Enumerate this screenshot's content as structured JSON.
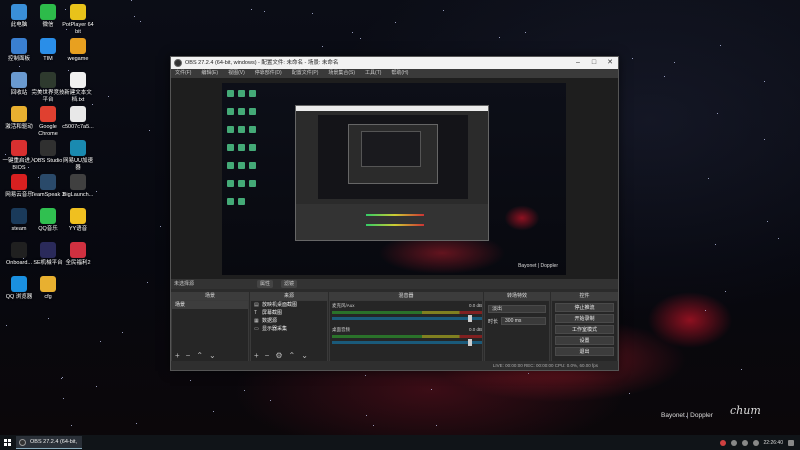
{
  "desktop": {
    "icons": [
      {
        "label": "此电脑",
        "icon": "computer-icon",
        "color": "#3a8fd8"
      },
      {
        "label": "微信",
        "icon": "wechat-icon",
        "color": "#2dbb4a"
      },
      {
        "label": "PotPlayer 64 bit",
        "icon": "potplayer-icon",
        "color": "#e8c21a"
      },
      {
        "label": "控制面板",
        "icon": "control-panel-icon",
        "color": "#3a7fd0"
      },
      {
        "label": "TIM",
        "icon": "tim-icon",
        "color": "#2a8ee8"
      },
      {
        "label": "wegame",
        "icon": "wegame-icon",
        "color": "#e8a020"
      },
      {
        "label": "回收站",
        "icon": "recycle-bin-icon",
        "color": "#6a9ad0"
      },
      {
        "label": "完美世界竞技平台",
        "icon": "perfect-world-icon",
        "color": "#2e3a2e"
      },
      {
        "label": "新建文本文档.txt",
        "icon": "text-file-icon",
        "color": "#f0f0f0"
      },
      {
        "label": "激活和驱动",
        "icon": "folder-icon",
        "color": "#e8b030"
      },
      {
        "label": "Google Chrome",
        "icon": "chrome-icon",
        "color": "#e04030"
      },
      {
        "label": "c5007c7a5...",
        "icon": "image-file-icon",
        "color": "#e8e8e8"
      },
      {
        "label": "一键重启进入BIOS",
        "icon": "bios-icon",
        "color": "#d83030"
      },
      {
        "label": "OBS Studio",
        "icon": "obs-icon",
        "color": "#303030"
      },
      {
        "label": "网易UU加速器",
        "icon": "uu-booster-icon",
        "color": "#1a8ab0"
      },
      {
        "label": "网易云音乐",
        "icon": "netease-music-icon",
        "color": "#d82020"
      },
      {
        "label": "TeamSpeak 3",
        "icon": "teamspeak-icon",
        "color": "#2a4a6a"
      },
      {
        "label": "BigLaunch...",
        "icon": "biglauncher-icon",
        "color": "#404040"
      },
      {
        "label": "steam",
        "icon": "steam-icon",
        "color": "#1a3a5a"
      },
      {
        "label": "QQ音乐",
        "icon": "qq-music-icon",
        "color": "#30c050"
      },
      {
        "label": "YY语音",
        "icon": "yy-icon",
        "color": "#f0c020"
      },
      {
        "label": "Onboard...",
        "icon": "onboard-icon",
        "color": "#202020"
      },
      {
        "label": "SE机械平台",
        "icon": "se-icon",
        "color": "#2a2a5a"
      },
      {
        "label": "全民福利2",
        "icon": "welfare-icon",
        "color": "#d03040"
      },
      {
        "label": "QQ 浏览器",
        "icon": "qq-browser-icon",
        "color": "#1a90e0"
      },
      {
        "label": "cfg",
        "icon": "folder-icon",
        "color": "#e8b030"
      }
    ]
  },
  "obs": {
    "title": "OBS 27.2.4 (64-bit, windows) - 配置文件: 未命名 - 场景: 未命名",
    "menu": [
      "文件(F)",
      "编辑(E)",
      "视图(V)",
      "停靠部件(D)",
      "配置文件(P)",
      "场景集合(S)",
      "工具(T)",
      "帮助(H)"
    ],
    "scene_bar": {
      "label": "未选择源",
      "properties": "属性",
      "filters": "滤镜"
    },
    "docks": {
      "scenes": "场景",
      "sources": "来源",
      "mixer": "混音器",
      "transitions": "转场特效",
      "controls": "控件"
    },
    "scenes_list": [
      "场景"
    ],
    "sources_list": [
      "放映机桌面截图",
      "屏幕截图",
      "数据源",
      "显示器采集"
    ],
    "mixer": [
      {
        "name": "麦克风/Aux",
        "db": "0.0 dB"
      },
      {
        "name": "桌面音频",
        "db": "0.0 dB"
      }
    ],
    "transitions": {
      "type": "淡出",
      "duration_label": "时长",
      "duration": "300 ms"
    },
    "controls": [
      "停止推流",
      "开始录制",
      "工作室模式",
      "设置",
      "退出"
    ],
    "status": "LIVE: 00:00:00   REC: 00:00:00   CPU: 0.0%, 60.00 fps",
    "preview_signature": "Bayonet | Doppler"
  },
  "wallpaper": {
    "signature": "Bayonet | Doppler",
    "script": "chum"
  },
  "taskbar": {
    "task_label": "OBS 27.2.4 (64-bit, ...",
    "clock": "22:26:40"
  },
  "colors": {
    "accent": "#2a7a2a",
    "window_bg": "#2b2b2b"
  }
}
